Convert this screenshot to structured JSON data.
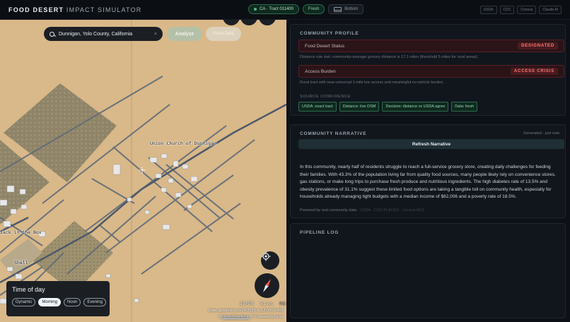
{
  "app": {
    "brand_bold": "FOOD DESERT",
    "brand_light": " IMPACT SIMULATOR"
  },
  "top": {
    "tract": "CA · Tract 011400",
    "fresh": "Fresh",
    "bottom": "Bottom",
    "sources": [
      "USDA",
      "CDC",
      "Census",
      "Claude AI"
    ]
  },
  "map": {
    "search_value": "Dunnigan, Yolo County, California",
    "clear": "×",
    "analyze": "Analyze",
    "fresh_data": "Fresh Data",
    "labels": [
      "Union Church of Dunnigan",
      "Jack in the Box",
      "Shell"
    ],
    "time_of_day": {
      "title": "Time of day",
      "options": [
        "Dynamic",
        "Morning",
        "Noon",
        "Evening"
      ],
      "active": "Morning"
    },
    "fps": "30 FPS",
    "ms": "5.1 ms",
    "rg": "RG",
    "date": "Data updated on 6/24/2023 at 12:00:00 AM",
    "attribution_pre": "© ",
    "attribution_osm": "OpenStreetMap",
    "attribution_post": " © Powered by Esri"
  },
  "profile": {
    "title": "COMMUNITY PROFILE",
    "status_label": "Food Desert Status",
    "status_badge": "DESIGNATED",
    "status_note": "Distance rule met: community-average grocery distance is 17.1 miles (threshold 5 miles for rural areas).",
    "burden_label": "Access Burden",
    "burden_badge": "ACCESS CRISIS",
    "burden_note": "Rural tract with near-universal 1-mile low access and meaningful no-vehicle burden.",
    "source_conf": "SOURCE CONFIDENCE",
    "conf_chips": [
      "USDA: exact tract",
      "Distance: live OSM",
      "Decision: distance vs USDA agree",
      "Data: fresh"
    ]
  },
  "narrative": {
    "title": "COMMUNITY NARRATIVE",
    "generated": "Generated · just now",
    "refresh": "Refresh Narrative",
    "text": "In this community, nearly half of residents struggle to reach a full-service grocery store, creating daily challenges for feeding their families. With 43.3% of the population living far from quality food sources, many people likely rely on convenience stores, gas stations, or make long trips to purchase fresh produce and nutritious ingredients. The high diabetes rate of 13.5% and obesity prevalence of 31.1% suggest these limited food options are taking a tangible toll on community health, especially for households already managing tight budgets with a median income of $62,006 and a poverty rate of 18.5%.",
    "powered": "Powered by real community data",
    "powered_src": " · USDA · CDC PLACES · Census ACS"
  },
  "pipeline": {
    "title": "PIPELINE LOG"
  },
  "colors": {
    "map_ground": "#d9b889",
    "accent_green": "#52b788",
    "danger": "#ff7b72"
  }
}
